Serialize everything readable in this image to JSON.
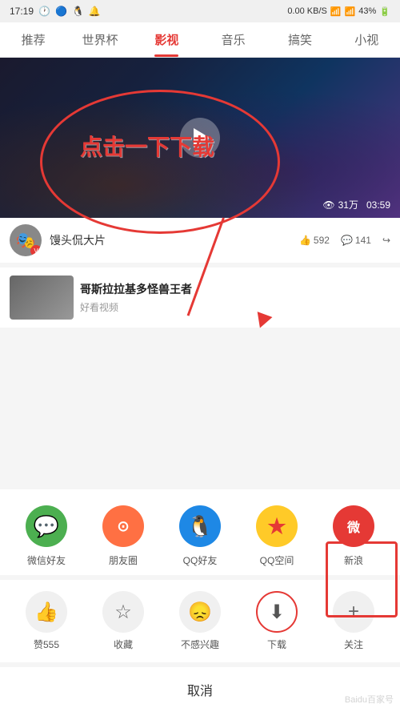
{
  "statusBar": {
    "time": "17:19",
    "network": "0.00 KB/S",
    "signal": "43%",
    "icons": [
      "alarm",
      "bluetooth",
      "qq",
      "notification"
    ]
  },
  "navTabs": {
    "items": [
      {
        "label": "推荐",
        "active": false
      },
      {
        "label": "世界杯",
        "active": false
      },
      {
        "label": "影视",
        "active": true
      },
      {
        "label": "音乐",
        "active": false
      },
      {
        "label": "搞笑",
        "active": false
      },
      {
        "label": "小视",
        "active": false
      }
    ]
  },
  "video": {
    "viewCount": "31万",
    "duration": "03:59",
    "uploader": "馒头侃大片",
    "likes": "592",
    "comments": "141"
  },
  "contentCard": {
    "title": "哥斯拉",
    "subtitle": "兽王者",
    "tag": "好看视频"
  },
  "annotation": {
    "text": "点击一下下载"
  },
  "shareItems": [
    {
      "label": "微信好友",
      "icon": "💬",
      "iconClass": "wechat-icon"
    },
    {
      "label": "朋友圈",
      "icon": "◉",
      "iconClass": "moments-icon"
    },
    {
      "label": "QQ好友",
      "icon": "🐧",
      "iconClass": "qq-icon"
    },
    {
      "label": "QQ空间",
      "icon": "★",
      "iconClass": "qqzone-icon"
    },
    {
      "label": "新浪",
      "icon": "微",
      "iconClass": "weibo-icon"
    }
  ],
  "actionItems": [
    {
      "label": "赞555",
      "icon": "👍"
    },
    {
      "label": "收藏",
      "icon": "☆"
    },
    {
      "label": "不感兴趣",
      "icon": "😞"
    },
    {
      "label": "下载",
      "icon": "⬇",
      "highlight": true
    },
    {
      "label": "关注",
      "icon": "+"
    }
  ],
  "cancelLabel": "取消",
  "watermark": "Baidu百家号"
}
